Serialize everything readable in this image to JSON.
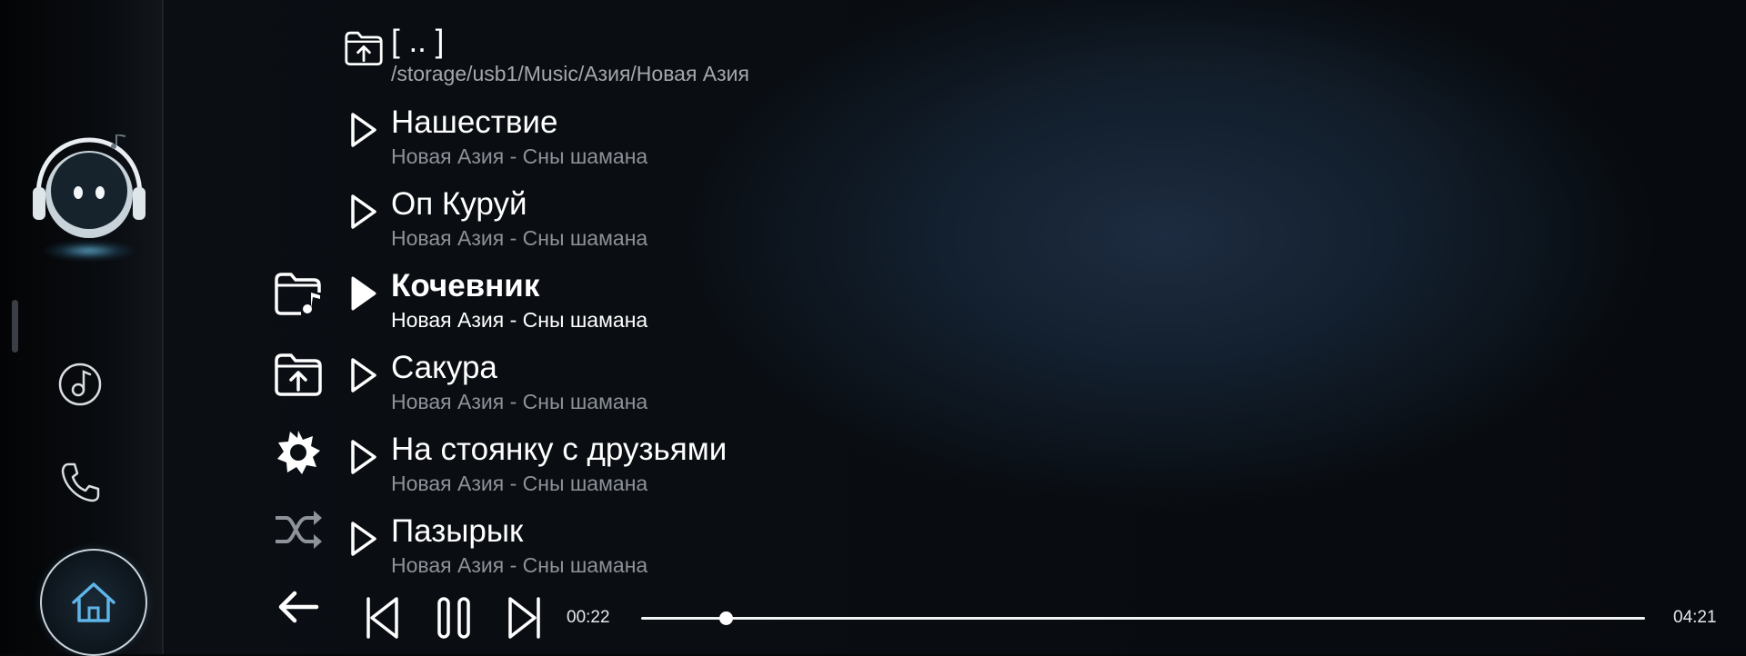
{
  "parent_dir": {
    "title": "[ .. ]",
    "path": "/storage/usb1/Music/Азия/Новая Азия"
  },
  "tracks": [
    {
      "title": "Нашествие",
      "subtitle": "Новая Азия - Сны шамана",
      "playing": false
    },
    {
      "title": "Оп Куруй",
      "subtitle": "Новая Азия - Сны шамана",
      "playing": false
    },
    {
      "title": "Кочевник",
      "subtitle": "Новая Азия - Сны шамана",
      "playing": true
    },
    {
      "title": "Сакура",
      "subtitle": "Новая Азия - Сны шамана",
      "playing": false
    },
    {
      "title": "На стоянку с друзьями",
      "subtitle": "Новая Азия - Сны шамана",
      "playing": false
    },
    {
      "title": "Пазырык",
      "subtitle": "Новая Азия - Сны шамана",
      "playing": false
    }
  ],
  "player": {
    "elapsed": "00:22",
    "total": "04:21",
    "progress": 0.084
  },
  "icons": {
    "dock": [
      "assistant-avatar",
      "music-app-icon",
      "phone-icon",
      "home-icon"
    ],
    "side": [
      "music-folder-icon",
      "upload-folder-icon",
      "effects-icon",
      "shuffle-icon"
    ],
    "transport": [
      "back-arrow-icon",
      "previous-track-icon",
      "pause-icon",
      "next-track-icon"
    ]
  },
  "colors": {
    "background": "#050709",
    "accent": "#5fa8c8",
    "text": "#ffffff",
    "subtext": "#8d9299",
    "home_icon": "#5fb4e8"
  }
}
